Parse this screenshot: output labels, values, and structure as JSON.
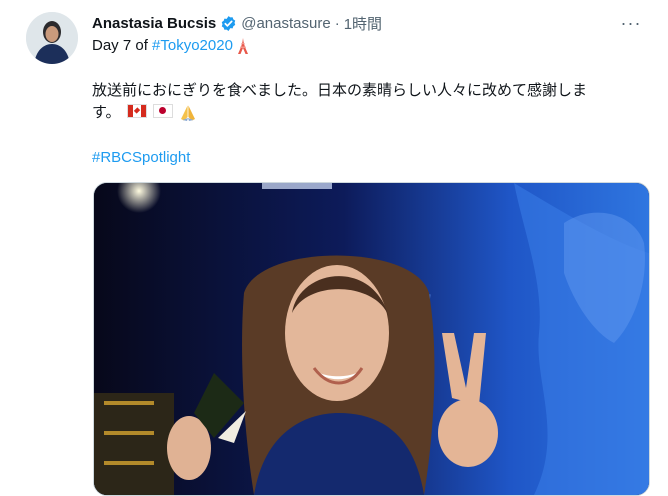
{
  "tweet": {
    "author_name": "Anastasia Bucsis",
    "handle": "@anastasure",
    "separator": "·",
    "time": "1時間",
    "more_icon": "more-icon",
    "line1_prefix": "Day 7 of ",
    "line1_hashtag": "#Tokyo2020",
    "line1_emoji": "tokyo-tower-icon",
    "body_line1": "放送前におにぎりを食べました。日本の素晴らしい人々に改めて感謝しま",
    "body_line2": "す。",
    "emojis": [
      "canada-flag-icon",
      "japan-flag-icon",
      "folded-hands-icon"
    ],
    "hashtag2": "#RBCSpotlight"
  },
  "colors": {
    "link": "#1d9bf0",
    "verified": "#1d9bf0",
    "secondary_text": "#536471"
  }
}
